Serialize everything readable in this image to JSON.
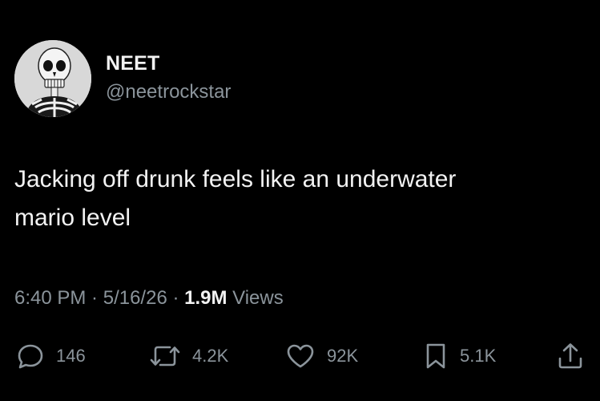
{
  "tweet": {
    "author": {
      "display_name": "NEET",
      "handle": "@neetrockstar",
      "avatar_icon": "skeleton-avatar"
    },
    "text_line1": "Jacking off drunk feels like an underwater",
    "text_line2": "mario level",
    "meta": {
      "time": "6:40 PM",
      "separator": " · ",
      "date": "5/16/26",
      "views_count": "1.9M",
      "views_label": " Views"
    },
    "actions": {
      "reply": {
        "icon": "reply-icon",
        "count": "146"
      },
      "repost": {
        "icon": "repost-icon",
        "count": "4.2K"
      },
      "like": {
        "icon": "heart-icon",
        "count": "92K"
      },
      "bookmark": {
        "icon": "bookmark-icon",
        "count": "5.1K"
      },
      "share": {
        "icon": "share-icon"
      }
    }
  },
  "colors": {
    "background": "#000000",
    "primary_text": "#f2f2f2",
    "secondary_text": "#8b949b"
  }
}
